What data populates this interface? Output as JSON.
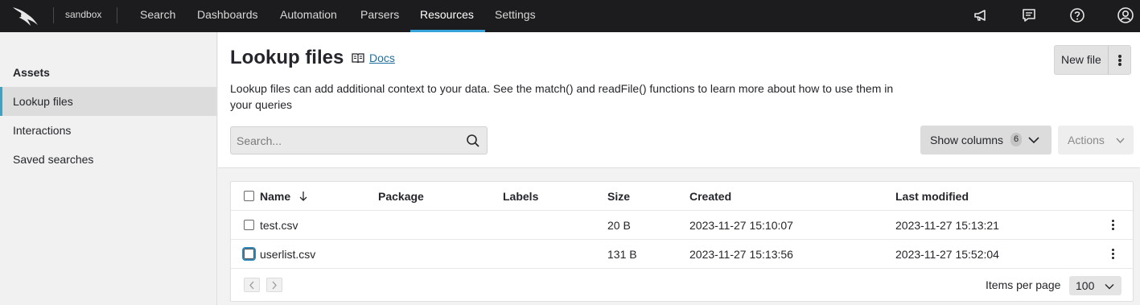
{
  "topbar": {
    "environment": "sandbox",
    "nav": [
      "Search",
      "Dashboards",
      "Automation",
      "Parsers",
      "Resources",
      "Settings"
    ],
    "active_nav": "Resources",
    "accent_color": "#36a3d9"
  },
  "sidebar": {
    "heading": "Assets",
    "items": [
      {
        "label": "Lookup files",
        "active": true
      },
      {
        "label": "Interactions",
        "active": false
      },
      {
        "label": "Saved searches",
        "active": false
      }
    ]
  },
  "header": {
    "title": "Lookup files",
    "docs_label": "Docs",
    "description": "Lookup files can add additional context to your data. See the match() and readFile() functions to learn more about how to use them in your queries",
    "new_file_label": "New file"
  },
  "search": {
    "placeholder": "Search..."
  },
  "toolbar": {
    "show_columns_label": "Show columns",
    "show_columns_count": "6",
    "actions_label": "Actions"
  },
  "table": {
    "columns": [
      "Name",
      "Package",
      "Labels",
      "Size",
      "Created",
      "Last modified"
    ],
    "rows": [
      {
        "name": "test.csv",
        "package": "",
        "labels": "",
        "size": "20 B",
        "created": "2023-11-27 15:10:07",
        "modified": "2023-11-27 15:13:21"
      },
      {
        "name": "userlist.csv",
        "package": "",
        "labels": "",
        "size": "131 B",
        "created": "2023-11-27 15:13:56",
        "modified": "2023-11-27 15:52:04"
      }
    ]
  },
  "pagination": {
    "items_per_page_label": "Items per page",
    "items_per_page_value": "100"
  }
}
